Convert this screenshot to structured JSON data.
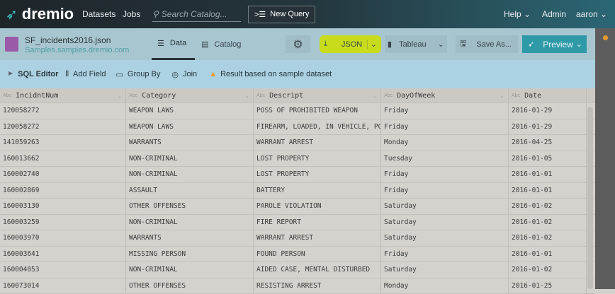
{
  "nav": {
    "logo": "dremio",
    "datasets": "Datasets",
    "jobs": "Jobs",
    "search_placeholder": "Search Catalog...",
    "new_query": "New Query",
    "help": "Help",
    "admin": "Admin",
    "user": "aaron"
  },
  "dataset": {
    "name": "SF_incidents2016.json",
    "source": "Samples.samples.dremio.com",
    "tab_data": "Data",
    "tab_catalog": "Catalog"
  },
  "actions": {
    "export": "JSON",
    "bi": "Tableau",
    "save": "Save As...",
    "preview": "Preview"
  },
  "toolbar": {
    "sql_editor": "SQL Editor",
    "add_field": "Add Field",
    "group_by": "Group By",
    "join": "Join",
    "warning": "Result based on sample dataset"
  },
  "table": {
    "type_label": "Abc",
    "columns": [
      "IncidntNum",
      "Category",
      "Descript",
      "DayOfWeek",
      "Date"
    ],
    "rows": [
      [
        "120058272",
        "WEAPON LAWS",
        "POSS OF PROHIBITED WEAPON",
        "Friday",
        "2016-01-29"
      ],
      [
        "120058272",
        "WEAPON LAWS",
        "FIREARM, LOADED, IN VEHICLE, POSSESSION OR USE",
        "Friday",
        "2016-01-29"
      ],
      [
        "141059263",
        "WARRANTS",
        "WARRANT ARREST",
        "Monday",
        "2016-04-25"
      ],
      [
        "160013662",
        "NON-CRIMINAL",
        "LOST PROPERTY",
        "Tuesday",
        "2016-01-05"
      ],
      [
        "160002740",
        "NON-CRIMINAL",
        "LOST PROPERTY",
        "Friday",
        "2016-01-01"
      ],
      [
        "160002869",
        "ASSAULT",
        "BATTERY",
        "Friday",
        "2016-01-01"
      ],
      [
        "160003130",
        "OTHER OFFENSES",
        "PAROLE VIOLATION",
        "Saturday",
        "2016-01-02"
      ],
      [
        "160003259",
        "NON-CRIMINAL",
        "FIRE REPORT",
        "Saturday",
        "2016-01-02"
      ],
      [
        "160003970",
        "WARRANTS",
        "WARRANT ARREST",
        "Saturday",
        "2016-01-02"
      ],
      [
        "160003641",
        "MISSING PERSON",
        "FOUND PERSON",
        "Friday",
        "2016-01-01"
      ],
      [
        "160004053",
        "NON-CRIMINAL",
        "AIDED CASE, MENTAL DISTURBED",
        "Saturday",
        "2016-01-02"
      ],
      [
        "160073014",
        "OTHER OFFENSES",
        "RESISTING ARREST",
        "Monday",
        "2016-01-25"
      ]
    ]
  }
}
